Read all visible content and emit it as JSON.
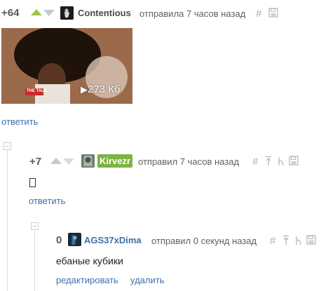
{
  "comments": [
    {
      "rating": "+64",
      "username": "Contentious",
      "action": "отправила 7 часов назад",
      "gif_size": "273 Кб",
      "gif_tv_logo": "THE TALK",
      "reply_label": "ответить"
    },
    {
      "rating": "+7",
      "username": "Kirvezr",
      "action": "отправил 7 часов назад",
      "body": "",
      "reply_label": "ответить"
    },
    {
      "rating": "0",
      "username": "AGS37xDima",
      "action": "отправил 0 секунд назад",
      "body": "ебаные кубики",
      "edit_label": "редактировать",
      "delete_label": "удалить"
    }
  ],
  "colors": {
    "upvote_active": "#9fc34a",
    "link": "#3e6fa8",
    "badge": "#7cb342"
  },
  "icons": [
    "hash-icon",
    "save-icon",
    "parent-icon",
    "branch-icon",
    "collapse-icon"
  ]
}
